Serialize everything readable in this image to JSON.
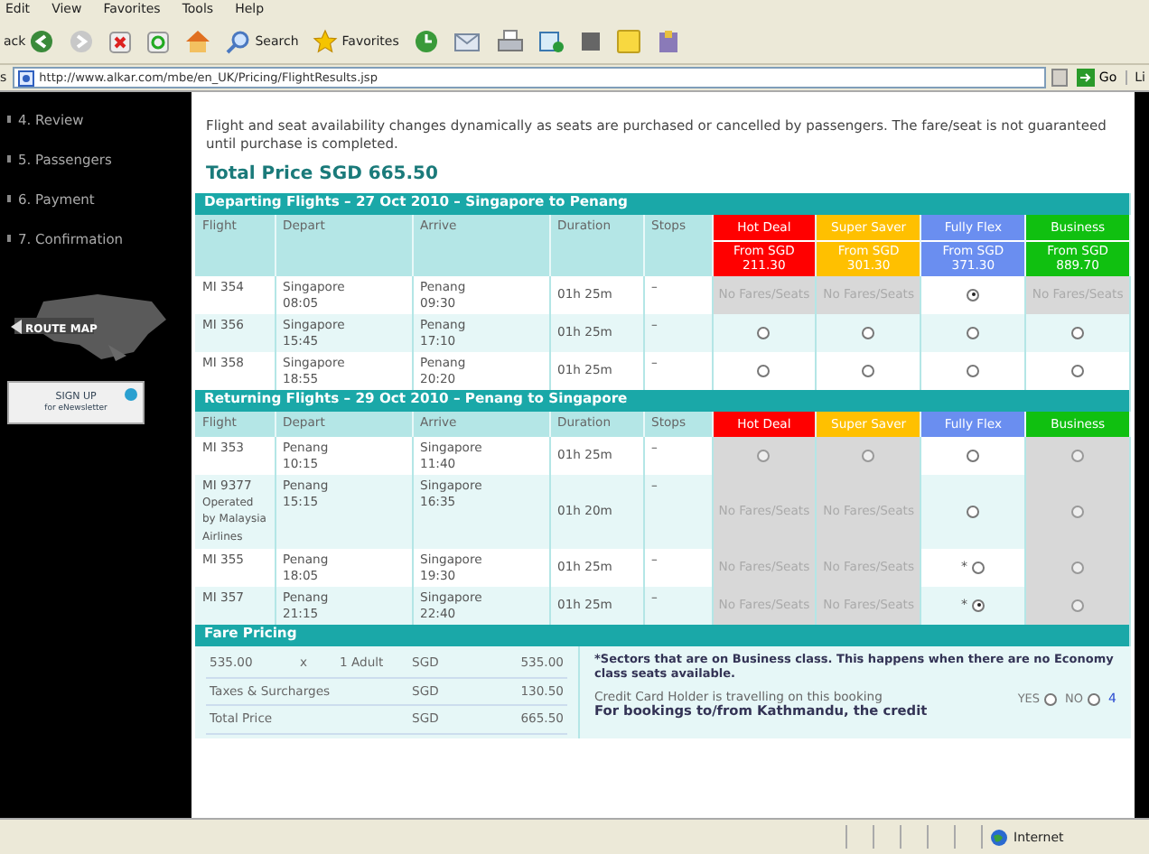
{
  "browser": {
    "menu": [
      "Edit",
      "View",
      "Favorites",
      "Tools",
      "Help"
    ],
    "toolbar": [
      {
        "kind": "back",
        "label": "ack"
      },
      {
        "kind": "forward"
      },
      {
        "kind": "stop"
      },
      {
        "kind": "refresh"
      },
      {
        "kind": "home"
      },
      {
        "kind": "search",
        "label": "Search"
      },
      {
        "kind": "favorites",
        "label": "Favorites"
      },
      {
        "kind": "history"
      },
      {
        "kind": "mail"
      },
      {
        "kind": "print"
      },
      {
        "kind": "edit"
      },
      {
        "kind": "block"
      },
      {
        "kind": "note"
      },
      {
        "kind": "tool"
      }
    ],
    "address_label": "s",
    "url": "http://www.alkar.com/mbe/en_UK/Pricing/FlightResults.jsp",
    "go": "Go",
    "links": "Li"
  },
  "sidebar": {
    "steps": [
      "4. Review",
      "5. Passengers",
      "6. Payment",
      "7. Confirmation"
    ],
    "route_map": "ROUTE MAP",
    "signup": {
      "title": "SIGN UP",
      "subtitle": "for eNewsletter"
    }
  },
  "notice": "Flight and seat availability changes dynamically as seats are purchased or cancelled by passengers. The fare/seat is not guaranteed until purchase is completed.",
  "total_price": "Total Price SGD 665.50",
  "sections": [
    {
      "title": "Departing Flights – 27 Oct 2010 – Singapore to Penang",
      "columns": [
        "Flight",
        "Depart",
        "Arrive",
        "Duration",
        "Stops"
      ],
      "fare_columns": [
        {
          "name": "Hot Deal",
          "color": "#ff0000",
          "from": "From SGD",
          "price": "211.30"
        },
        {
          "name": "Super Saver",
          "color": "#ffc000",
          "from": "From SGD",
          "price": "301.30"
        },
        {
          "name": "Fully Flex",
          "color": "#6a8ef0",
          "from": "From SGD",
          "price": "371.30"
        },
        {
          "name": "Business",
          "color": "#10c010",
          "from": "From SGD",
          "price": "889.70"
        }
      ],
      "rows": [
        {
          "flight": "MI 354",
          "depart_city": "Singapore",
          "depart_time": "08:05",
          "arrive_city": "Penang",
          "arrive_time": "09:30",
          "duration": "01h 25m",
          "stops": "–",
          "fares": [
            {
              "kind": "none",
              "text": "No Fares/Seats"
            },
            {
              "kind": "none",
              "text": "No Fares/Seats"
            },
            {
              "kind": "radio",
              "selected": true,
              "disabled": false
            },
            {
              "kind": "none",
              "text": "No Fares/Seats"
            }
          ]
        },
        {
          "flight": "MI 356",
          "depart_city": "Singapore",
          "depart_time": "15:45",
          "arrive_city": "Penang",
          "arrive_time": "17:10",
          "duration": "01h 25m",
          "stops": "–",
          "fares": [
            {
              "kind": "radio",
              "selected": false,
              "disabled": false
            },
            {
              "kind": "radio",
              "selected": false,
              "disabled": false
            },
            {
              "kind": "radio",
              "selected": false,
              "disabled": false
            },
            {
              "kind": "radio",
              "selected": false,
              "disabled": false
            }
          ]
        },
        {
          "flight": "MI 358",
          "depart_city": "Singapore",
          "depart_time": "18:55",
          "arrive_city": "Penang",
          "arrive_time": "20:20",
          "duration": "01h 25m",
          "stops": "–",
          "fares": [
            {
              "kind": "radio",
              "selected": false,
              "disabled": false
            },
            {
              "kind": "radio",
              "selected": false,
              "disabled": false
            },
            {
              "kind": "radio",
              "selected": false,
              "disabled": false
            },
            {
              "kind": "radio",
              "selected": false,
              "disabled": false
            }
          ]
        }
      ]
    },
    {
      "title": "Returning Flights – 29 Oct 2010 – Penang to Singapore",
      "columns": [
        "Flight",
        "Depart",
        "Arrive",
        "Duration",
        "Stops"
      ],
      "fare_columns": [
        {
          "name": "Hot Deal",
          "color": "#ff0000"
        },
        {
          "name": "Super Saver",
          "color": "#ffc000"
        },
        {
          "name": "Fully Flex",
          "color": "#6a8ef0"
        },
        {
          "name": "Business",
          "color": "#10c010"
        }
      ],
      "rows": [
        {
          "flight": "MI 353",
          "depart_city": "Penang",
          "depart_time": "10:15",
          "arrive_city": "Singapore",
          "arrive_time": "11:40",
          "duration": "01h 25m",
          "stops": "–",
          "fares": [
            {
              "kind": "radio",
              "selected": false,
              "disabled": true
            },
            {
              "kind": "radio",
              "selected": false,
              "disabled": true
            },
            {
              "kind": "radio",
              "selected": false,
              "disabled": false
            },
            {
              "kind": "radio",
              "selected": false,
              "disabled": true
            }
          ]
        },
        {
          "flight": "MI 9377",
          "operator": "Operated by Malaysia Airlines",
          "depart_city": "Penang",
          "depart_time": "15:15",
          "arrive_city": "Singapore",
          "arrive_time": "16:35",
          "duration": "01h 20m",
          "stops": "–",
          "fares": [
            {
              "kind": "none",
              "text": "No Fares/Seats"
            },
            {
              "kind": "none",
              "text": "No Fares/Seats"
            },
            {
              "kind": "radio",
              "selected": false,
              "disabled": false
            },
            {
              "kind": "radio",
              "selected": false,
              "disabled": true
            }
          ]
        },
        {
          "flight": "MI 355",
          "depart_city": "Penang",
          "depart_time": "18:05",
          "arrive_city": "Singapore",
          "arrive_time": "19:30",
          "duration": "01h 25m",
          "stops": "–",
          "fares": [
            {
              "kind": "none",
              "text": "No Fares/Seats"
            },
            {
              "kind": "none",
              "text": "No Fares/Seats"
            },
            {
              "kind": "radio",
              "selected": false,
              "disabled": false,
              "note": "*"
            },
            {
              "kind": "radio",
              "selected": false,
              "disabled": true
            }
          ]
        },
        {
          "flight": "MI 357",
          "depart_city": "Penang",
          "depart_time": "21:15",
          "arrive_city": "Singapore",
          "arrive_time": "22:40",
          "duration": "01h 25m",
          "stops": "–",
          "fares": [
            {
              "kind": "none",
              "text": "No Fares/Seats"
            },
            {
              "kind": "none",
              "text": "No Fares/Seats"
            },
            {
              "kind": "radio",
              "selected": true,
              "disabled": false,
              "note": "*"
            },
            {
              "kind": "radio",
              "selected": false,
              "disabled": true
            }
          ]
        }
      ]
    }
  ],
  "pricing": {
    "title": "Fare Pricing",
    "rows": [
      {
        "label": "535.00",
        "times": "x",
        "qty": "1 Adult",
        "currency": "SGD",
        "amount": "535.00"
      },
      {
        "label": "Taxes & Surcharges",
        "currency": "SGD",
        "amount": "130.50"
      },
      {
        "label": "Total Price",
        "currency": "SGD",
        "amount": "665.50"
      }
    ],
    "note": "*Sectors that are on Business class. This happens when there are no Economy class seats available.",
    "credit": {
      "question": "Credit Card Holder is travelling on this booking",
      "options": [
        {
          "label": "YES",
          "selected": false
        },
        {
          "label": "NO",
          "selected": false
        }
      ],
      "extra": "4"
    },
    "kathmandu": "For bookings to/from Kathmandu, the credit"
  },
  "status_bar": {
    "zone": "Internet"
  }
}
